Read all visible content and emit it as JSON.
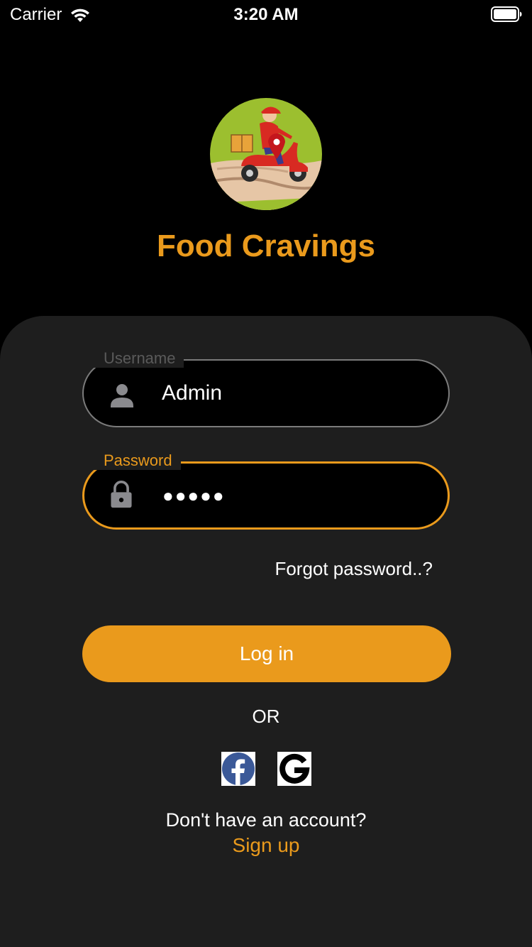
{
  "status_bar": {
    "carrier": "Carrier",
    "time": "3:20 AM",
    "wifi_icon": "wifi-icon",
    "battery_icon": "battery-full-icon"
  },
  "header": {
    "logo_icon": "delivery-scooter-logo",
    "title": "Food Cravings"
  },
  "login_form": {
    "username": {
      "label": "Username",
      "value": "Admin",
      "icon": "person-icon"
    },
    "password": {
      "label": "Password",
      "value": "●●●●●",
      "icon": "lock-icon"
    },
    "forgot_password": "Forgot password..?",
    "login_button": "Log in",
    "or_divider": "OR",
    "social": [
      {
        "name": "facebook",
        "icon": "facebook-icon"
      },
      {
        "name": "google",
        "icon": "google-icon"
      }
    ],
    "no_account": "Don't have an account?",
    "sign_up": "Sign up"
  },
  "colors": {
    "accent": "#ea9a1c",
    "card_background": "#1e1e1e",
    "page_background": "#000000",
    "inactive_border": "#7b7b7b"
  }
}
